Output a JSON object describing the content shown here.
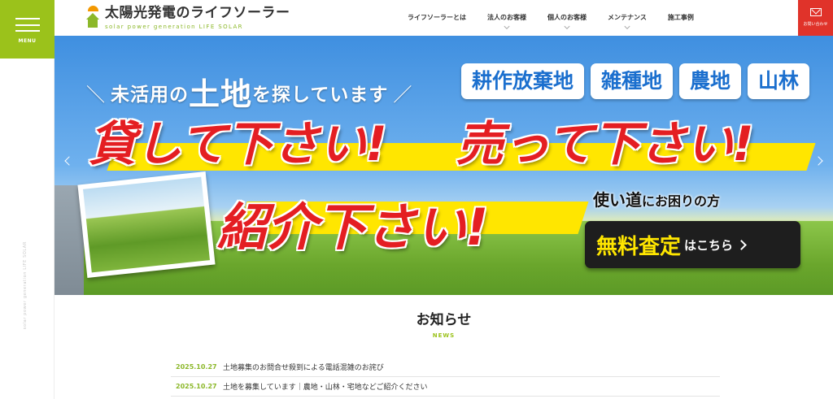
{
  "menu": {
    "label": "MENU"
  },
  "side": {
    "vertical_text": "solar power generation LIFE SOLAR"
  },
  "logo": {
    "title": "太陽光発電のライフソーラー",
    "subtitle": "solar power generation  LIFE SOLAR"
  },
  "nav": [
    {
      "label": "ライフソーラーとは",
      "has_dropdown": false
    },
    {
      "label": "法人のお客様",
      "has_dropdown": true
    },
    {
      "label": "個人のお客様",
      "has_dropdown": true
    },
    {
      "label": "メンテナンス",
      "has_dropdown": true
    },
    {
      "label": "施工事例",
      "has_dropdown": false
    }
  ],
  "contact": {
    "label": "お問い合わせ",
    "icon": "mail-icon"
  },
  "hero": {
    "headline_pre": "未活用の",
    "headline_big": "土地",
    "headline_post": "を探しています",
    "tags": [
      "耕作放棄地",
      "雑種地",
      "農地",
      "山林"
    ],
    "slogan1": "貸して下さい!",
    "slogan2": "売って下さい!",
    "slogan3": "紹介下さい!",
    "usage_a": "使い道",
    "usage_b": "にお困りの方",
    "cta_strong": "無料査定",
    "cta_rest": "はこちら"
  },
  "news": {
    "title": "お知らせ",
    "subtitle": "NEWS",
    "items": [
      {
        "date": "2025.10.27",
        "text": "土地募集のお問合せ殺到による電話混雑のお詫び"
      },
      {
        "date": "2025.10.27",
        "text": "土地を募集しています｜農地・山林・宅地などご紹介ください"
      }
    ]
  },
  "colors": {
    "accent_green": "#9bc21b",
    "contact_red": "#e0332a",
    "slogan_red": "#e41e22",
    "tag_blue": "#1b6fce"
  }
}
